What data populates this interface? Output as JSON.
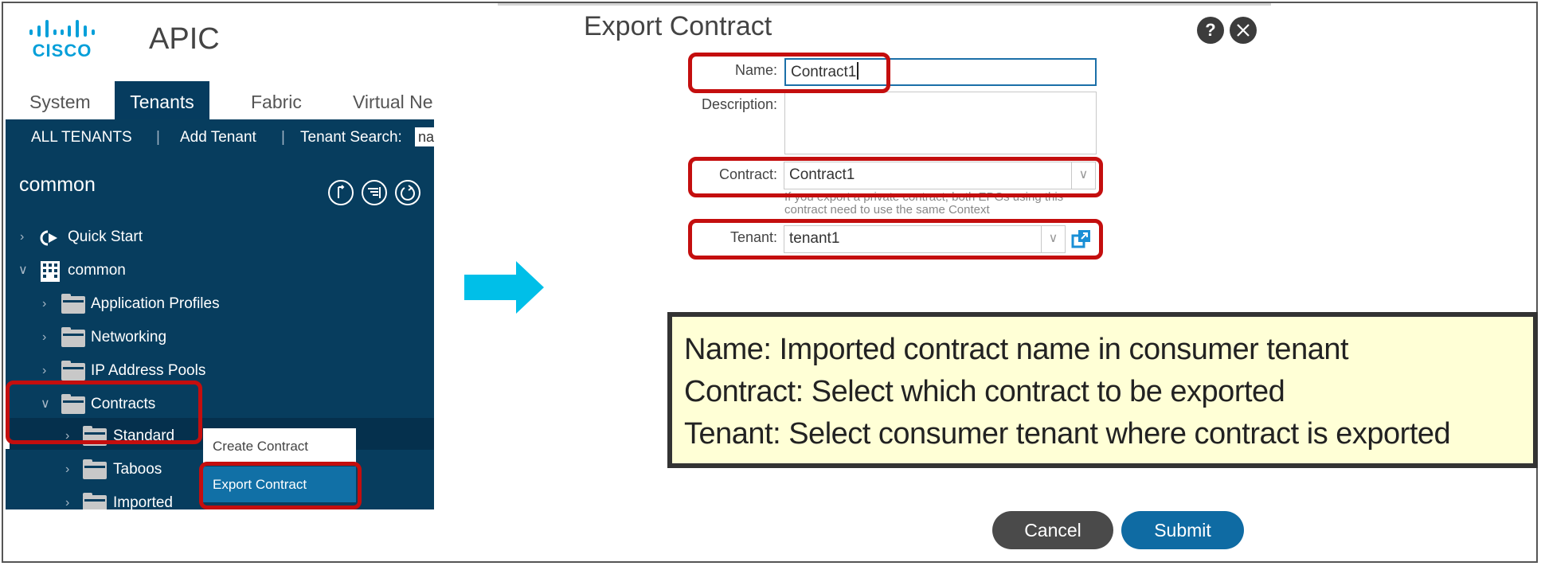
{
  "left_panel": {
    "logo_text": "CISCO",
    "app_title": "APIC",
    "tabs": [
      {
        "label": "System",
        "active": false
      },
      {
        "label": "Tenants",
        "active": true
      },
      {
        "label": "Fabric",
        "active": false
      },
      {
        "label": "Virtual Ne",
        "active": false
      }
    ],
    "subnav": {
      "all_tenants": "ALL TENANTS",
      "separator": "|",
      "add_tenant": "Add Tenant",
      "tenant_search_label": "Tenant Search:",
      "tenant_search_value": "na"
    },
    "current_tenant": "common",
    "toolbar_icons": [
      "collapse-icon",
      "filter-icon",
      "refresh-icon"
    ],
    "tree": [
      {
        "label": "Quick Start",
        "icon": "quick-start-icon",
        "expanded": false
      },
      {
        "label": "common",
        "icon": "tenant-building-icon",
        "expanded": true
      },
      {
        "label": "Application Profiles",
        "icon": "folder-icon",
        "expanded": false
      },
      {
        "label": "Networking",
        "icon": "folder-icon",
        "expanded": false
      },
      {
        "label": "IP Address Pools",
        "icon": "folder-icon",
        "expanded": false
      },
      {
        "label": "Contracts",
        "icon": "folder-icon",
        "expanded": true
      },
      {
        "label": "Standard",
        "icon": "folder-icon",
        "expanded": false,
        "selected": true
      },
      {
        "label": "Taboos",
        "icon": "folder-icon",
        "expanded": false
      },
      {
        "label": "Imported",
        "icon": "folder-icon",
        "expanded": false
      }
    ],
    "context_menu": [
      {
        "label": "Create Contract",
        "highlighted": false
      },
      {
        "label": "Export Contract",
        "highlighted": true
      }
    ]
  },
  "dialog": {
    "title": "Export Contract",
    "help_icon": "?",
    "fields": {
      "name": {
        "label": "Name:",
        "value": "Contract1"
      },
      "description": {
        "label": "Description:",
        "value": ""
      },
      "contract": {
        "label": "Contract:",
        "value": "Contract1",
        "helper": "If you export a private contract, both EPGs using this contract need to use the same Context"
      },
      "tenant": {
        "label": "Tenant:",
        "value": "tenant1"
      }
    },
    "buttons": {
      "cancel": "Cancel",
      "submit": "Submit"
    }
  },
  "annotation": {
    "lines": [
      "Name: Imported contract name in consumer tenant",
      "Contract: Select which contract to be exported",
      "Tenant: Select consumer tenant where contract is exported"
    ]
  },
  "colors": {
    "panel_bg": "#073d5e",
    "highlight_red": "#c40e0e",
    "arrow": "#00bfe8",
    "submit_blue": "#0f6ba3",
    "cancel_grey": "#4a4a4a",
    "note_bg": "#ffffd6",
    "cisco_blue": "#049fd9"
  }
}
